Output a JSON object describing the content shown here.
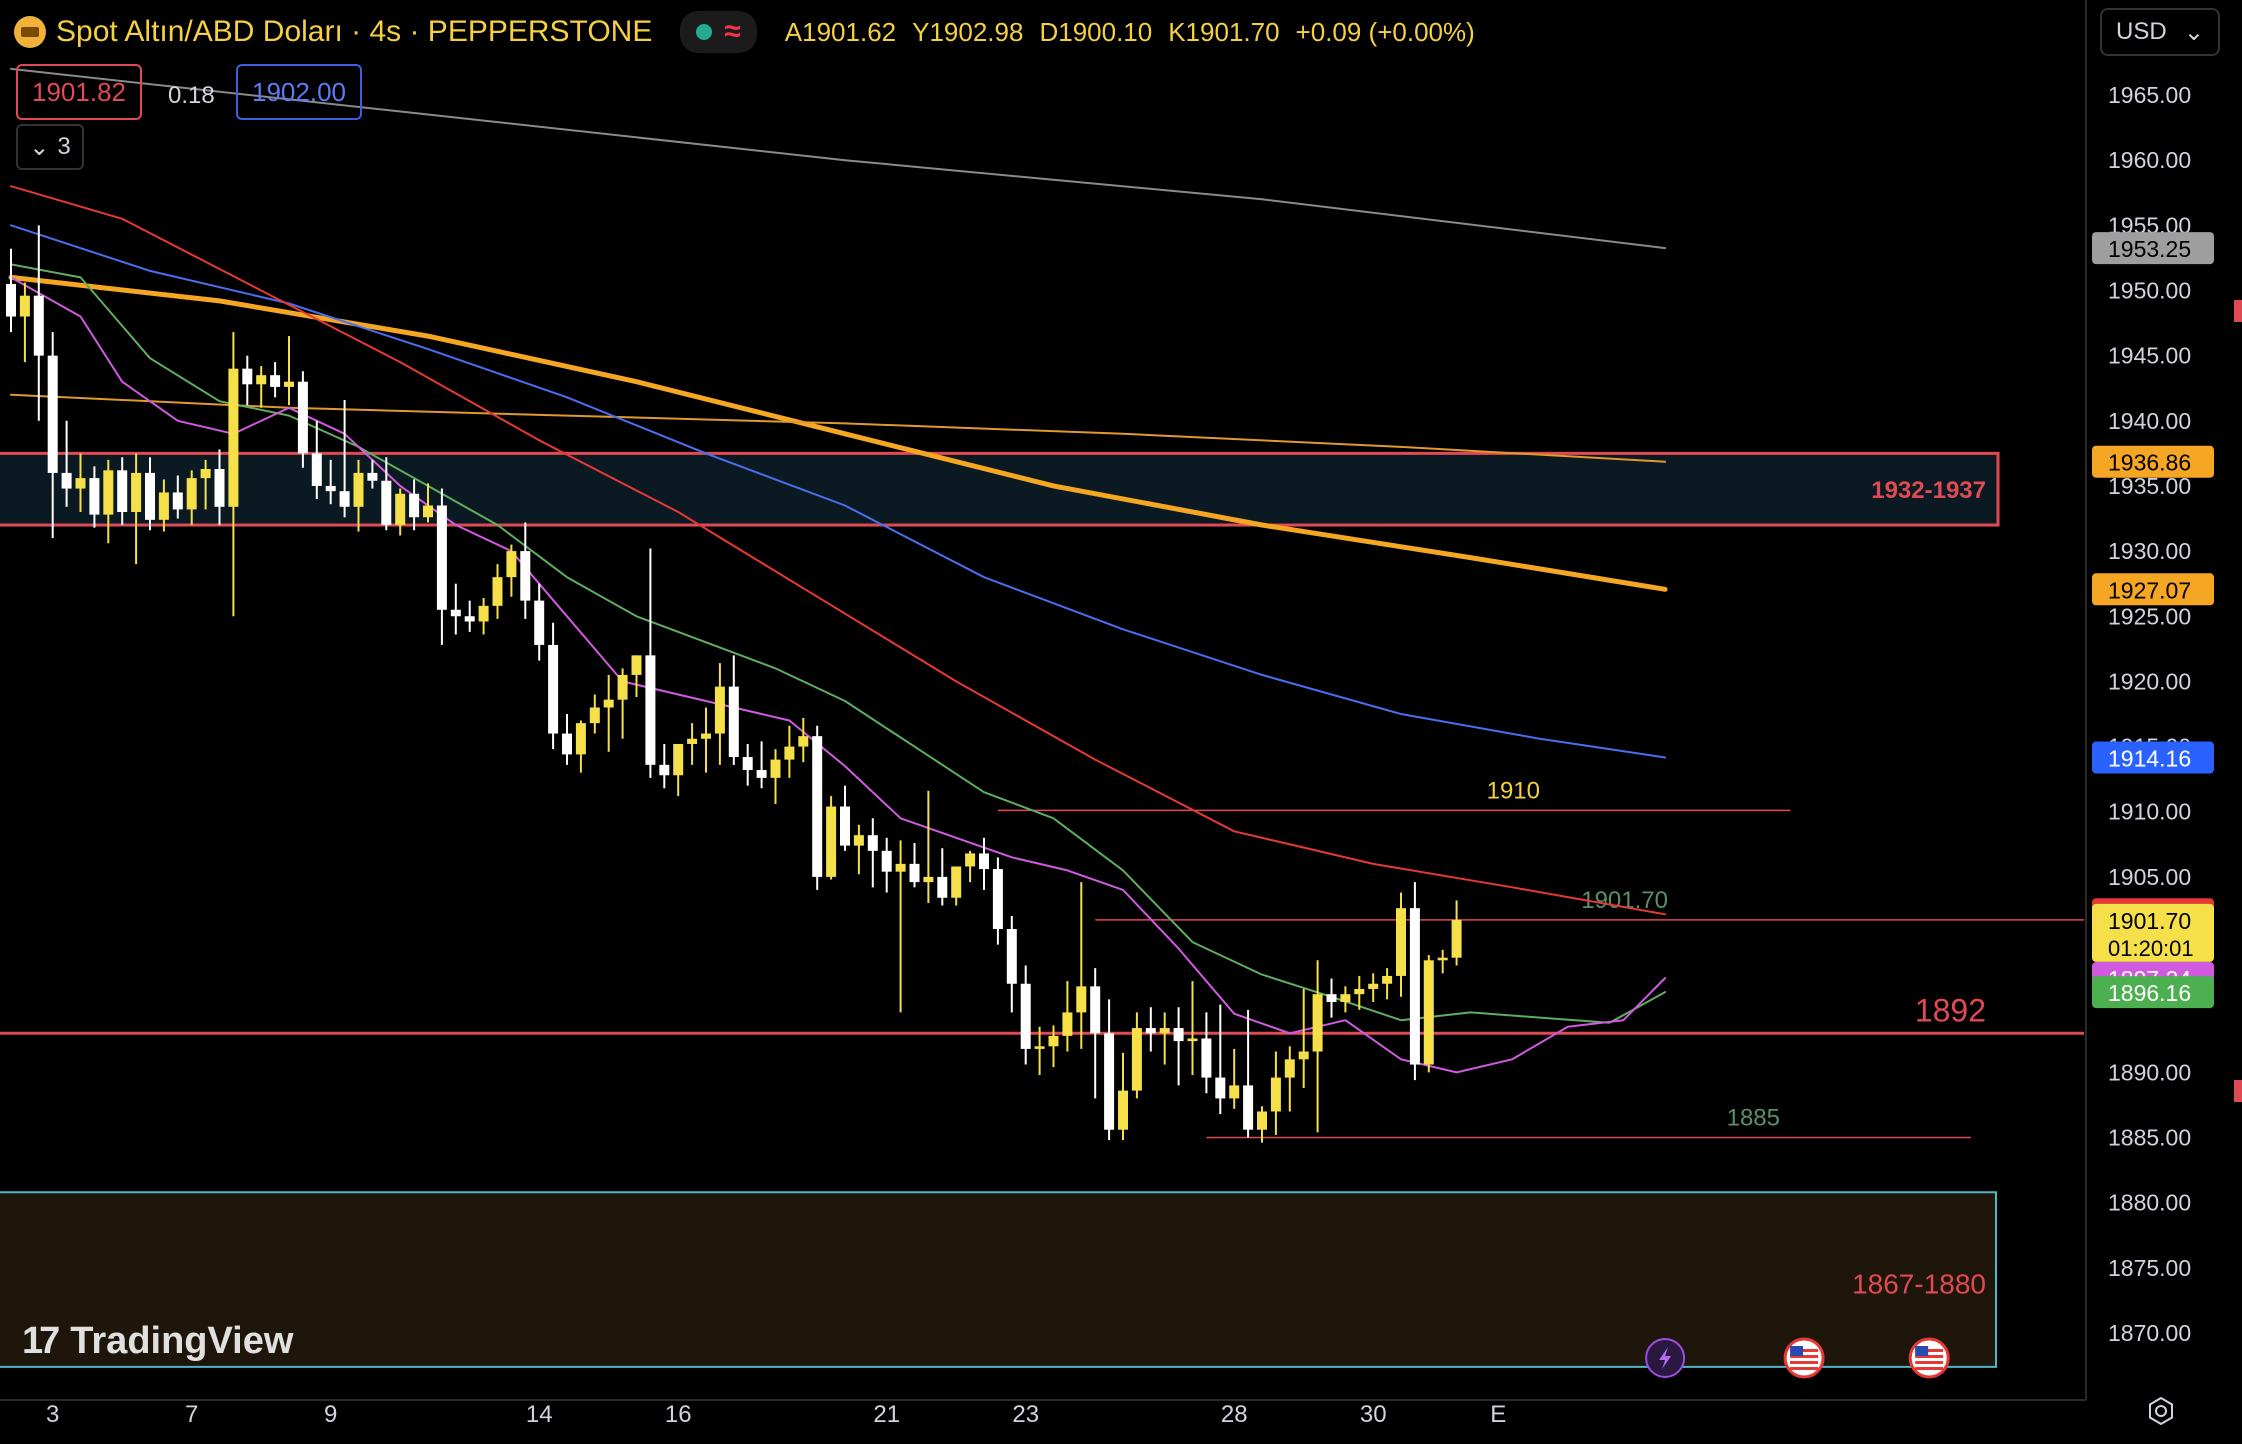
{
  "header": {
    "symbol_title": "Spot Altın/ABD Doları · 4s · PEPPERSTONE",
    "status_icon": "market-open-dot",
    "wave_icon": "≈",
    "ohlc": {
      "open": "A1901.62",
      "high": "Y1902.98",
      "low": "D1900.10",
      "close": "K1901.70",
      "change": "+0.09 (+0.00%)"
    }
  },
  "quote": {
    "bid": "1901.82",
    "spread": "0.18",
    "ask": "1902.00"
  },
  "indicators_toggle": {
    "icon": "chevron-down-icon",
    "count": "3"
  },
  "currency": {
    "label": "USD",
    "icon": "chevron-down-icon"
  },
  "branding": {
    "logo_text": "TradingView",
    "logo_mark": "17"
  },
  "colors": {
    "background": "#000000",
    "bull": "#f5e04a",
    "bear": "#ffffff",
    "resistance": "#e04a52",
    "zone_fill_upper": "#0b1a22",
    "zone_fill_lower": "#1e160a",
    "zone_border_lower": "#4fb6c4",
    "ma_gray": "#8a8a8a",
    "ma_orange_thick": "#f5a623",
    "ma_orange_thin": "#e09a2c",
    "ma_blue": "#4a6ef0",
    "ma_red": "#e53935",
    "ma_green": "#5fae5f",
    "ma_magenta": "#d05ae0"
  },
  "chart_data": {
    "type": "candlestick",
    "ylim": [
      1866,
      1968
    ],
    "xlabel": "",
    "ylabel": "",
    "y_ticks": [
      "1965.00",
      "1960.00",
      "1955.00",
      "1950.00",
      "1945.00",
      "1940.00",
      "1935.00",
      "1930.00",
      "1925.00",
      "1920.00",
      "1915.00",
      "1910.00",
      "1905.00",
      "1890.00",
      "1885.00",
      "1880.00",
      "1875.00",
      "1870.00"
    ],
    "x_ticks": [
      {
        "label": "3",
        "index": 3
      },
      {
        "label": "7",
        "index": 13
      },
      {
        "label": "9",
        "index": 23
      },
      {
        "label": "14",
        "index": 38
      },
      {
        "label": "16",
        "index": 48
      },
      {
        "label": "21",
        "index": 63
      },
      {
        "label": "23",
        "index": 73
      },
      {
        "label": "28",
        "index": 88
      },
      {
        "label": "30",
        "index": 98
      },
      {
        "label": "E",
        "index": 107
      }
    ],
    "candles": [
      [
        1950.5,
        1953.2,
        1946.8,
        1948.0
      ],
      [
        1948.0,
        1950.6,
        1944.5,
        1949.6
      ],
      [
        1949.6,
        1955.0,
        1940.0,
        1945.0
      ],
      [
        1945.0,
        1946.8,
        1931.0,
        1936.0
      ],
      [
        1936.0,
        1940.0,
        1933.4,
        1934.8
      ],
      [
        1934.8,
        1937.5,
        1933.0,
        1935.6
      ],
      [
        1935.6,
        1936.5,
        1931.8,
        1932.8
      ],
      [
        1932.8,
        1937.0,
        1930.6,
        1936.2
      ],
      [
        1936.2,
        1937.2,
        1932.0,
        1933.0
      ],
      [
        1933.0,
        1937.5,
        1929.0,
        1936.0
      ],
      [
        1936.0,
        1937.2,
        1931.6,
        1932.4
      ],
      [
        1932.4,
        1935.5,
        1931.5,
        1934.5
      ],
      [
        1934.5,
        1935.8,
        1932.5,
        1933.2
      ],
      [
        1933.2,
        1936.2,
        1932.0,
        1935.6
      ],
      [
        1935.6,
        1937.0,
        1933.2,
        1936.3
      ],
      [
        1936.3,
        1937.8,
        1932.0,
        1933.4
      ],
      [
        1933.4,
        1946.8,
        1925.0,
        1944.0
      ],
      [
        1944.0,
        1945.0,
        1941.2,
        1942.8
      ],
      [
        1942.8,
        1944.2,
        1941.0,
        1943.5
      ],
      [
        1943.5,
        1944.5,
        1941.8,
        1942.6
      ],
      [
        1942.6,
        1946.5,
        1941.2,
        1943.0
      ],
      [
        1943.0,
        1943.8,
        1936.4,
        1937.5
      ],
      [
        1937.5,
        1940.0,
        1934.0,
        1935.0
      ],
      [
        1935.0,
        1937.0,
        1933.6,
        1934.6
      ],
      [
        1934.6,
        1941.6,
        1932.6,
        1933.4
      ],
      [
        1933.4,
        1937.0,
        1931.5,
        1936.0
      ],
      [
        1936.0,
        1937.0,
        1934.8,
        1935.4
      ],
      [
        1935.4,
        1937.2,
        1931.6,
        1932.0
      ],
      [
        1932.0,
        1934.8,
        1931.2,
        1934.4
      ],
      [
        1934.4,
        1935.5,
        1931.6,
        1932.6
      ],
      [
        1932.6,
        1935.2,
        1932.2,
        1933.5
      ],
      [
        1933.5,
        1934.8,
        1922.8,
        1925.5
      ],
      [
        1925.5,
        1927.5,
        1923.6,
        1925.0
      ],
      [
        1925.0,
        1926.2,
        1923.8,
        1924.6
      ],
      [
        1924.6,
        1926.4,
        1923.6,
        1925.8
      ],
      [
        1925.8,
        1929.0,
        1924.8,
        1928.0
      ],
      [
        1928.0,
        1930.5,
        1926.5,
        1930.0
      ],
      [
        1930.0,
        1932.2,
        1924.8,
        1926.2
      ],
      [
        1926.2,
        1927.5,
        1921.6,
        1922.8
      ],
      [
        1922.8,
        1924.5,
        1914.8,
        1916.0
      ],
      [
        1916.0,
        1917.5,
        1913.6,
        1914.4
      ],
      [
        1914.4,
        1917.0,
        1913.0,
        1916.8
      ],
      [
        1916.8,
        1919.0,
        1916.0,
        1918.0
      ],
      [
        1918.0,
        1920.5,
        1914.6,
        1918.6
      ],
      [
        1918.6,
        1921.0,
        1915.6,
        1920.5
      ],
      [
        1920.5,
        1922.0,
        1918.8,
        1922.0
      ],
      [
        1922.0,
        1930.2,
        1912.6,
        1913.6
      ],
      [
        1913.6,
        1915.2,
        1911.8,
        1912.8
      ],
      [
        1912.8,
        1914.5,
        1911.2,
        1915.2
      ],
      [
        1915.2,
        1916.8,
        1913.6,
        1915.6
      ],
      [
        1915.6,
        1918.0,
        1913.0,
        1916.0
      ],
      [
        1916.0,
        1921.4,
        1913.6,
        1919.6
      ],
      [
        1919.6,
        1922.0,
        1913.6,
        1914.2
      ],
      [
        1914.2,
        1915.2,
        1912.0,
        1913.2
      ],
      [
        1913.2,
        1915.4,
        1911.8,
        1912.6
      ],
      [
        1912.6,
        1914.8,
        1910.6,
        1914.0
      ],
      [
        1914.0,
        1916.6,
        1912.6,
        1915.0
      ],
      [
        1915.0,
        1917.2,
        1913.8,
        1915.8
      ],
      [
        1915.8,
        1916.6,
        1904.0,
        1905.0
      ],
      [
        1905.0,
        1911.2,
        1904.8,
        1910.4
      ],
      [
        1910.4,
        1912.0,
        1907.0,
        1907.4
      ],
      [
        1907.4,
        1909.0,
        1905.2,
        1908.2
      ],
      [
        1908.2,
        1909.5,
        1904.2,
        1907.0
      ],
      [
        1907.0,
        1908.0,
        1903.8,
        1905.4
      ],
      [
        1905.4,
        1907.8,
        1894.6,
        1906.0
      ],
      [
        1906.0,
        1907.6,
        1904.2,
        1904.6
      ],
      [
        1904.6,
        1911.6,
        1903.0,
        1905.0
      ],
      [
        1905.0,
        1907.2,
        1902.8,
        1903.4
      ],
      [
        1903.4,
        1905.6,
        1902.8,
        1905.8
      ],
      [
        1905.8,
        1907.0,
        1904.6,
        1906.8
      ],
      [
        1906.8,
        1908.0,
        1904.0,
        1905.6
      ],
      [
        1905.6,
        1906.5,
        1899.8,
        1901.0
      ],
      [
        1901.0,
        1902.0,
        1894.6,
        1896.8
      ],
      [
        1896.8,
        1898.2,
        1890.6,
        1891.8
      ],
      [
        1891.8,
        1893.5,
        1889.8,
        1892.0
      ],
      [
        1892.0,
        1893.6,
        1890.4,
        1892.8
      ],
      [
        1892.8,
        1897.0,
        1891.6,
        1894.6
      ],
      [
        1894.6,
        1904.6,
        1891.8,
        1896.6
      ],
      [
        1896.6,
        1898.0,
        1888.0,
        1893.0
      ],
      [
        1893.0,
        1895.6,
        1884.8,
        1885.6
      ],
      [
        1885.6,
        1891.5,
        1884.8,
        1888.6
      ],
      [
        1888.6,
        1894.6,
        1888.0,
        1893.4
      ],
      [
        1893.4,
        1895.0,
        1891.6,
        1893.0
      ],
      [
        1893.0,
        1894.6,
        1890.6,
        1893.4
      ],
      [
        1893.4,
        1895.0,
        1889.0,
        1892.4
      ],
      [
        1892.4,
        1897.0,
        1889.8,
        1892.6
      ],
      [
        1892.6,
        1894.6,
        1888.4,
        1889.6
      ],
      [
        1889.6,
        1895.2,
        1886.8,
        1888.0
      ],
      [
        1888.0,
        1891.8,
        1887.2,
        1889.0
      ],
      [
        1889.0,
        1894.8,
        1885.0,
        1885.6
      ],
      [
        1885.6,
        1887.4,
        1884.6,
        1887.0
      ],
      [
        1887.0,
        1891.6,
        1885.2,
        1889.6
      ],
      [
        1889.6,
        1892.0,
        1887.0,
        1891.0
      ],
      [
        1891.0,
        1896.4,
        1888.8,
        1891.6
      ],
      [
        1891.6,
        1898.6,
        1885.4,
        1896.0
      ],
      [
        1896.0,
        1897.2,
        1894.2,
        1895.4
      ],
      [
        1895.4,
        1896.6,
        1894.6,
        1896.0
      ],
      [
        1896.0,
        1897.4,
        1894.8,
        1896.4
      ],
      [
        1896.4,
        1897.6,
        1895.4,
        1896.8
      ],
      [
        1896.8,
        1898.0,
        1895.6,
        1897.4
      ],
      [
        1897.4,
        1903.8,
        1895.8,
        1902.6
      ],
      [
        1902.6,
        1904.6,
        1889.4,
        1890.6
      ],
      [
        1890.6,
        1899.0,
        1890.0,
        1898.6
      ],
      [
        1898.6,
        1899.4,
        1897.6,
        1898.8
      ],
      [
        1898.8,
        1903.2,
        1898.2,
        1901.7
      ]
    ],
    "moving_averages": [
      {
        "color": "#8a8a8a",
        "width": 2,
        "points": [
          [
            0,
            1967
          ],
          [
            30,
            1963.5
          ],
          [
            60,
            1960
          ],
          [
            90,
            1957
          ],
          [
            119,
            1953.25
          ]
        ]
      },
      {
        "color": "#f5a623",
        "width": 5,
        "points": [
          [
            0,
            1951
          ],
          [
            15,
            1949.2
          ],
          [
            30,
            1946.5
          ],
          [
            45,
            1943
          ],
          [
            60,
            1939
          ],
          [
            75,
            1935
          ],
          [
            90,
            1932
          ],
          [
            105,
            1929.5
          ],
          [
            119,
            1927.07
          ]
        ]
      },
      {
        "color": "#e09a2c",
        "width": 2,
        "points": [
          [
            0,
            1942
          ],
          [
            20,
            1941
          ],
          [
            40,
            1940.4
          ],
          [
            60,
            1939.8
          ],
          [
            80,
            1939
          ],
          [
            100,
            1938
          ],
          [
            119,
            1936.86
          ]
        ]
      },
      {
        "color": "#4a6ef0",
        "width": 2,
        "points": [
          [
            0,
            1955
          ],
          [
            10,
            1951.5
          ],
          [
            20,
            1949
          ],
          [
            30,
            1945.5
          ],
          [
            40,
            1941.8
          ],
          [
            50,
            1937.5
          ],
          [
            60,
            1933.5
          ],
          [
            70,
            1928
          ],
          [
            80,
            1924
          ],
          [
            90,
            1920.5
          ],
          [
            100,
            1917.5
          ],
          [
            110,
            1915.6
          ],
          [
            119,
            1914.16
          ]
        ]
      },
      {
        "color": "#e53935",
        "width": 2,
        "points": [
          [
            0,
            1958
          ],
          [
            8,
            1955.5
          ],
          [
            18,
            1950
          ],
          [
            28,
            1944.5
          ],
          [
            38,
            1938.5
          ],
          [
            48,
            1933
          ],
          [
            58,
            1926.5
          ],
          [
            68,
            1920
          ],
          [
            78,
            1914
          ],
          [
            88,
            1908.5
          ],
          [
            98,
            1906
          ],
          [
            108,
            1904.2
          ],
          [
            119,
            1902.13
          ]
        ]
      },
      {
        "color": "#5fae5f",
        "width": 2,
        "points": [
          [
            0,
            1952
          ],
          [
            5,
            1951
          ],
          [
            10,
            1944.8
          ],
          [
            15,
            1941.5
          ],
          [
            20,
            1940.4
          ],
          [
            25,
            1938
          ],
          [
            30,
            1935
          ],
          [
            35,
            1932
          ],
          [
            40,
            1928
          ],
          [
            45,
            1925
          ],
          [
            50,
            1923
          ],
          [
            55,
            1921
          ],
          [
            60,
            1918.5
          ],
          [
            65,
            1915
          ],
          [
            70,
            1911.5
          ],
          [
            75,
            1909.5
          ],
          [
            80,
            1905.5
          ],
          [
            85,
            1900
          ],
          [
            90,
            1897.5
          ],
          [
            95,
            1895.8
          ],
          [
            100,
            1894
          ],
          [
            105,
            1894.6
          ],
          [
            110,
            1894.2
          ],
          [
            115,
            1893.8
          ],
          [
            119,
            1896.16
          ]
        ]
      },
      {
        "color": "#d05ae0",
        "width": 2,
        "points": [
          [
            0,
            1951
          ],
          [
            5,
            1948
          ],
          [
            8,
            1943
          ],
          [
            12,
            1940
          ],
          [
            16,
            1939
          ],
          [
            20,
            1941
          ],
          [
            24,
            1939
          ],
          [
            28,
            1935
          ],
          [
            32,
            1932
          ],
          [
            36,
            1930
          ],
          [
            40,
            1925
          ],
          [
            44,
            1920
          ],
          [
            48,
            1919
          ],
          [
            52,
            1918
          ],
          [
            56,
            1917
          ],
          [
            60,
            1913.5
          ],
          [
            64,
            1909.5
          ],
          [
            68,
            1908
          ],
          [
            72,
            1906.5
          ],
          [
            76,
            1905.5
          ],
          [
            80,
            1904
          ],
          [
            84,
            1899.5
          ],
          [
            88,
            1894.5
          ],
          [
            92,
            1893
          ],
          [
            96,
            1894
          ],
          [
            100,
            1891
          ],
          [
            104,
            1890
          ],
          [
            108,
            1891
          ],
          [
            112,
            1893.5
          ],
          [
            116,
            1894
          ],
          [
            119,
            1897.24
          ]
        ]
      }
    ],
    "zones": [
      {
        "label": "1932-1937",
        "low": 1932.0,
        "high": 1937.5,
        "style": "resistance"
      },
      {
        "label": "1867-1880",
        "low": 1867.4,
        "high": 1880.8,
        "style": "demand"
      }
    ],
    "levels": [
      {
        "label": "1910",
        "price": 1910.1,
        "from": 71,
        "to": 128,
        "label_color": "#f5d042",
        "color": "#e04a52",
        "width": 1.5
      },
      {
        "label": "1901.70",
        "price": 1901.7,
        "from": 78,
        "to": 170,
        "label_color": "#5a8f6a",
        "color": "#e04a52",
        "width": 1.5
      },
      {
        "label": "1892",
        "price": 1893.0,
        "from": -2,
        "to": 165,
        "label_color": "#e04a52",
        "color": "#e04a52",
        "width": 3
      },
      {
        "label": "1885",
        "price": 1885.0,
        "from": 86,
        "to": 141,
        "label_color": "#5a8f6a",
        "color": "#e04a52",
        "width": 1.5
      }
    ],
    "price_labels": [
      {
        "text": "1953.25",
        "price": 1953.25,
        "bg": "#9e9e9e",
        "fg": "#000000"
      },
      {
        "text": "1936.86",
        "price": 1936.86,
        "bg": "#f5a623",
        "fg": "#000000"
      },
      {
        "text": "1927.07",
        "price": 1927.07,
        "bg": "#f5a623",
        "fg": "#000000"
      },
      {
        "text": "1914.16",
        "price": 1914.16,
        "bg": "#2962ff",
        "fg": "#ffffff"
      },
      {
        "text": "1902.13",
        "price": 1902.13,
        "bg": "#e53935",
        "fg": "#ffffff"
      },
      {
        "text": "1901.70",
        "price": 1901.7,
        "bg": "#f5e04a",
        "fg": "#000000",
        "sub": "01:20:01"
      },
      {
        "text": "1897.24",
        "price": 1897.24,
        "bg": "#d05ae0",
        "fg": "#ffffff"
      },
      {
        "text": "1896.16",
        "price": 1896.16,
        "bg": "#4caf50",
        "fg": "#ffffff"
      }
    ],
    "events": [
      {
        "icon": "lightning-icon",
        "index": 119
      },
      {
        "icon": "us-flag-icon",
        "index": 129
      },
      {
        "icon": "us-flag-icon",
        "index": 138
      }
    ]
  }
}
